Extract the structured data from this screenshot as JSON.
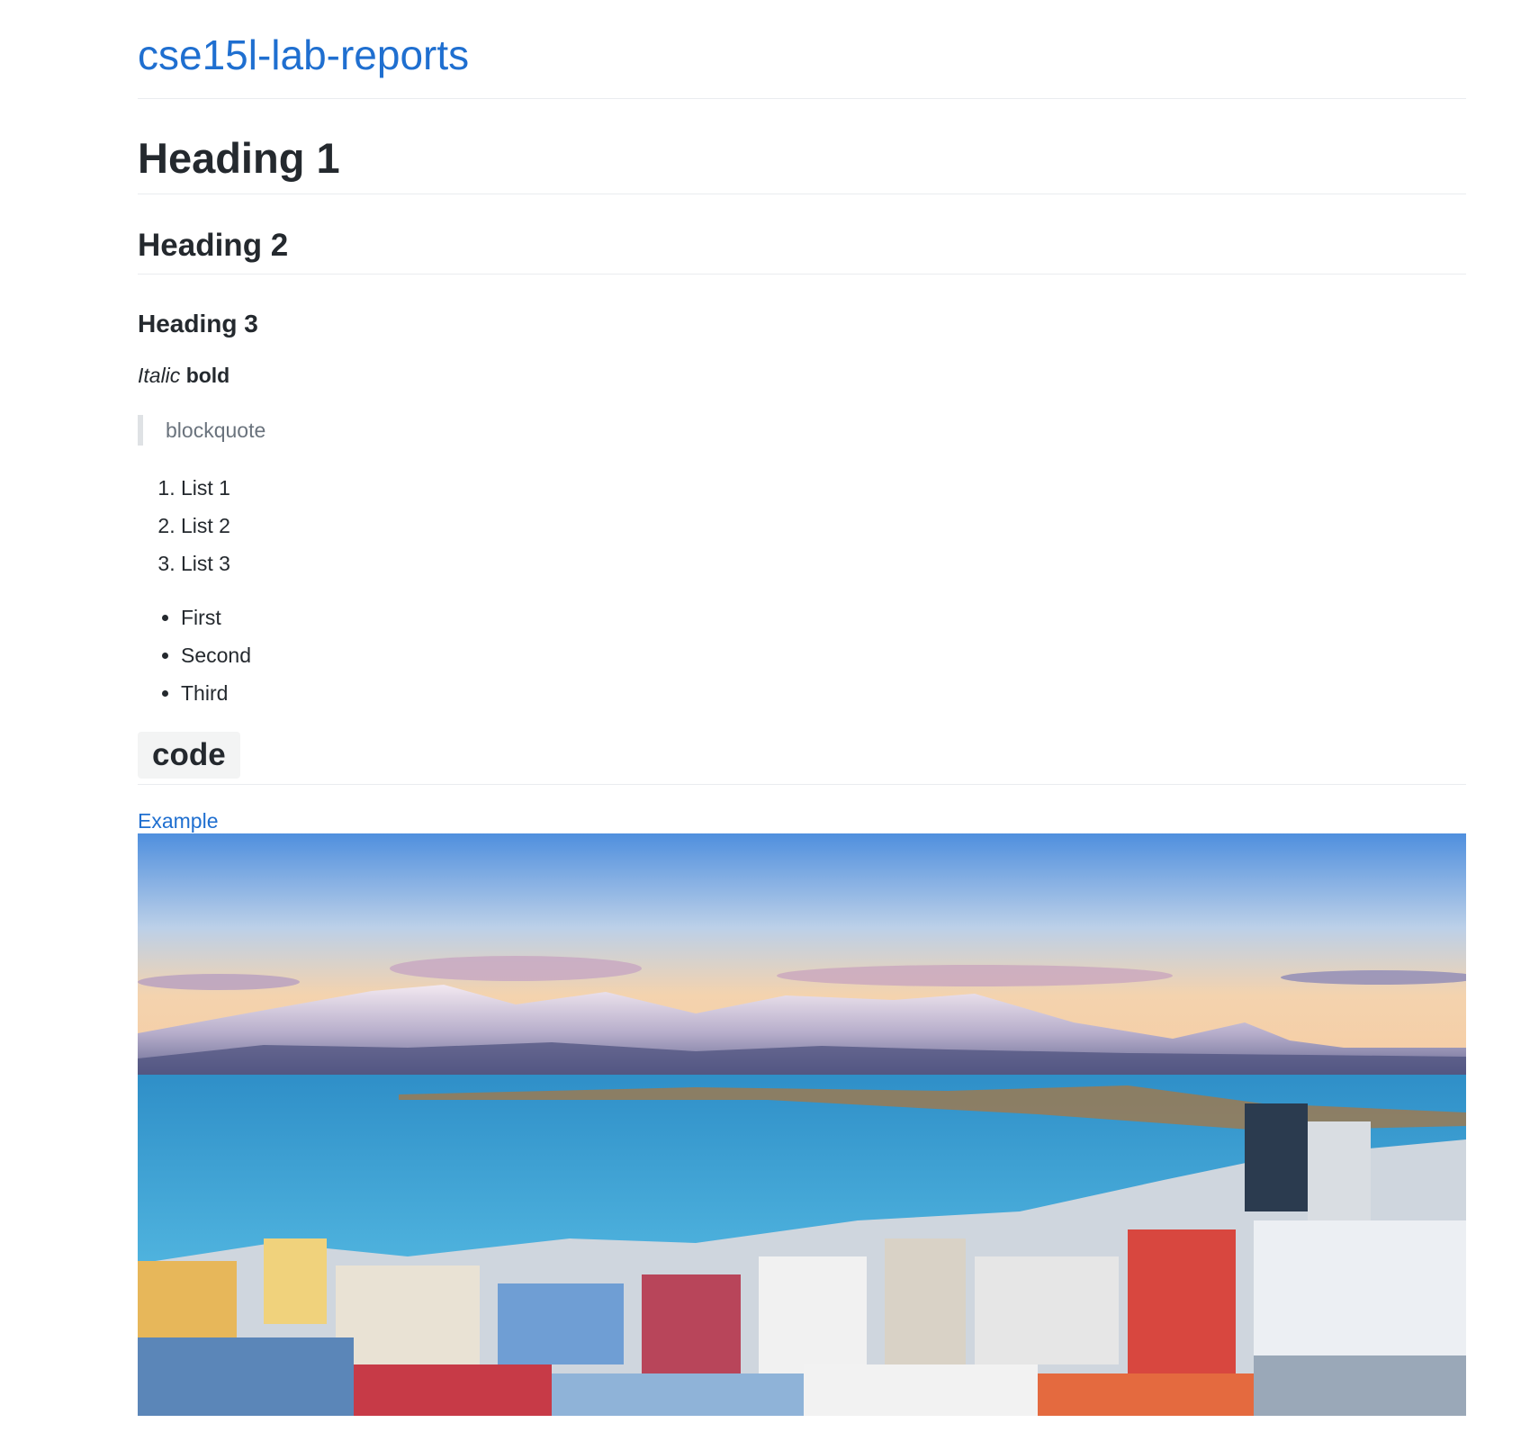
{
  "site": {
    "title": "cse15l-lab-reports"
  },
  "content": {
    "heading1": "Heading 1",
    "heading2": "Heading 2",
    "heading3": "Heading 3",
    "italic_text": "Italic",
    "bold_text": "bold",
    "blockquote": "blockquote",
    "ordered_list": [
      "List 1",
      "List 2",
      "List 3"
    ],
    "bullet_list": [
      "First",
      "Second",
      "Third"
    ],
    "code_heading": "code",
    "link_text": "Example"
  },
  "image": {
    "alt": "Photo of snowy mountains across a bay and a colorful city"
  },
  "colors": {
    "link": "#1f6fd0",
    "text": "#24292e",
    "muted": "#6a737d",
    "rule": "#eaecef"
  }
}
